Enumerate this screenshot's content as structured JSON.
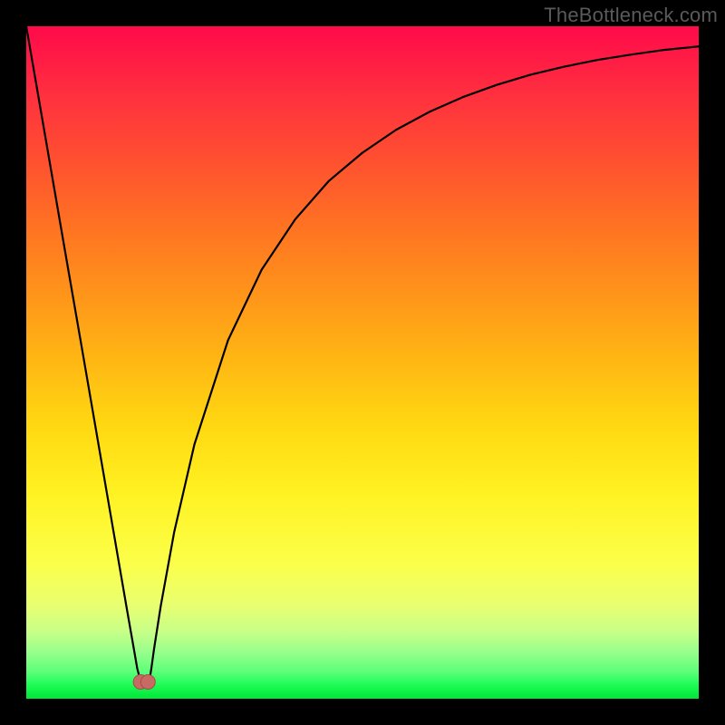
{
  "watermark": {
    "text": "TheBottleneck.com"
  },
  "colors": {
    "background": "#000000",
    "curve_stroke": "#000000",
    "marker_fill": "#c76a63",
    "marker_stroke": "#a24f49"
  },
  "chart_data": {
    "type": "line",
    "title": "",
    "xlabel": "",
    "ylabel": "",
    "xlim": [
      0,
      100
    ],
    "ylim": [
      0,
      100
    ],
    "grid": false,
    "legend": false,
    "series": [
      {
        "name": "bottleneck-curve",
        "x": [
          0,
          2,
          4,
          6,
          8,
          10,
          12,
          14,
          15,
          16,
          16.5,
          17,
          17.3,
          17.8,
          18.3,
          18.6,
          19,
          20,
          22,
          25,
          30,
          35,
          40,
          45,
          50,
          55,
          60,
          65,
          70,
          75,
          80,
          85,
          90,
          95,
          100
        ],
        "y": [
          100,
          88.4,
          76.8,
          65.2,
          53.7,
          42.1,
          30.5,
          18.9,
          13.1,
          7.4,
          4.5,
          2.6,
          2.1,
          2.1,
          2.6,
          4.5,
          7.4,
          13.8,
          24.8,
          37.8,
          53.3,
          63.8,
          71.3,
          77.0,
          81.2,
          84.6,
          87.3,
          89.5,
          91.3,
          92.8,
          94.0,
          95.0,
          95.8,
          96.5,
          97.0
        ]
      }
    ],
    "markers": [
      {
        "x": 17.0,
        "y": 2.5
      },
      {
        "x": 18.1,
        "y": 2.5
      }
    ]
  }
}
